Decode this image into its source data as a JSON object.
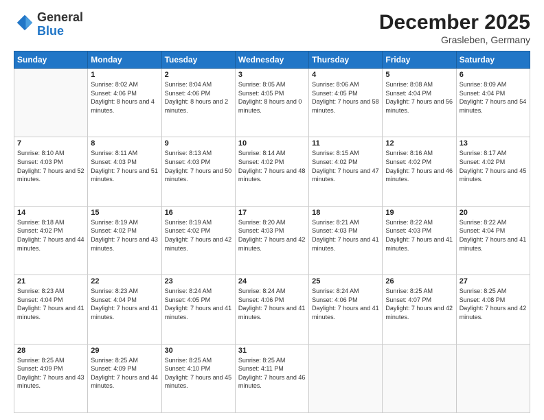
{
  "header": {
    "logo_general": "General",
    "logo_blue": "Blue",
    "month_title": "December 2025",
    "location": "Grasleben, Germany"
  },
  "weekdays": [
    "Sunday",
    "Monday",
    "Tuesday",
    "Wednesday",
    "Thursday",
    "Friday",
    "Saturday"
  ],
  "weeks": [
    [
      {
        "day": "",
        "sunrise": "",
        "sunset": "",
        "daylight": ""
      },
      {
        "day": "1",
        "sunrise": "Sunrise: 8:02 AM",
        "sunset": "Sunset: 4:06 PM",
        "daylight": "Daylight: 8 hours and 4 minutes."
      },
      {
        "day": "2",
        "sunrise": "Sunrise: 8:04 AM",
        "sunset": "Sunset: 4:06 PM",
        "daylight": "Daylight: 8 hours and 2 minutes."
      },
      {
        "day": "3",
        "sunrise": "Sunrise: 8:05 AM",
        "sunset": "Sunset: 4:05 PM",
        "daylight": "Daylight: 8 hours and 0 minutes."
      },
      {
        "day": "4",
        "sunrise": "Sunrise: 8:06 AM",
        "sunset": "Sunset: 4:05 PM",
        "daylight": "Daylight: 7 hours and 58 minutes."
      },
      {
        "day": "5",
        "sunrise": "Sunrise: 8:08 AM",
        "sunset": "Sunset: 4:04 PM",
        "daylight": "Daylight: 7 hours and 56 minutes."
      },
      {
        "day": "6",
        "sunrise": "Sunrise: 8:09 AM",
        "sunset": "Sunset: 4:04 PM",
        "daylight": "Daylight: 7 hours and 54 minutes."
      }
    ],
    [
      {
        "day": "7",
        "sunrise": "Sunrise: 8:10 AM",
        "sunset": "Sunset: 4:03 PM",
        "daylight": "Daylight: 7 hours and 52 minutes."
      },
      {
        "day": "8",
        "sunrise": "Sunrise: 8:11 AM",
        "sunset": "Sunset: 4:03 PM",
        "daylight": "Daylight: 7 hours and 51 minutes."
      },
      {
        "day": "9",
        "sunrise": "Sunrise: 8:13 AM",
        "sunset": "Sunset: 4:03 PM",
        "daylight": "Daylight: 7 hours and 50 minutes."
      },
      {
        "day": "10",
        "sunrise": "Sunrise: 8:14 AM",
        "sunset": "Sunset: 4:02 PM",
        "daylight": "Daylight: 7 hours and 48 minutes."
      },
      {
        "day": "11",
        "sunrise": "Sunrise: 8:15 AM",
        "sunset": "Sunset: 4:02 PM",
        "daylight": "Daylight: 7 hours and 47 minutes."
      },
      {
        "day": "12",
        "sunrise": "Sunrise: 8:16 AM",
        "sunset": "Sunset: 4:02 PM",
        "daylight": "Daylight: 7 hours and 46 minutes."
      },
      {
        "day": "13",
        "sunrise": "Sunrise: 8:17 AM",
        "sunset": "Sunset: 4:02 PM",
        "daylight": "Daylight: 7 hours and 45 minutes."
      }
    ],
    [
      {
        "day": "14",
        "sunrise": "Sunrise: 8:18 AM",
        "sunset": "Sunset: 4:02 PM",
        "daylight": "Daylight: 7 hours and 44 minutes."
      },
      {
        "day": "15",
        "sunrise": "Sunrise: 8:19 AM",
        "sunset": "Sunset: 4:02 PM",
        "daylight": "Daylight: 7 hours and 43 minutes."
      },
      {
        "day": "16",
        "sunrise": "Sunrise: 8:19 AM",
        "sunset": "Sunset: 4:02 PM",
        "daylight": "Daylight: 7 hours and 42 minutes."
      },
      {
        "day": "17",
        "sunrise": "Sunrise: 8:20 AM",
        "sunset": "Sunset: 4:03 PM",
        "daylight": "Daylight: 7 hours and 42 minutes."
      },
      {
        "day": "18",
        "sunrise": "Sunrise: 8:21 AM",
        "sunset": "Sunset: 4:03 PM",
        "daylight": "Daylight: 7 hours and 41 minutes."
      },
      {
        "day": "19",
        "sunrise": "Sunrise: 8:22 AM",
        "sunset": "Sunset: 4:03 PM",
        "daylight": "Daylight: 7 hours and 41 minutes."
      },
      {
        "day": "20",
        "sunrise": "Sunrise: 8:22 AM",
        "sunset": "Sunset: 4:04 PM",
        "daylight": "Daylight: 7 hours and 41 minutes."
      }
    ],
    [
      {
        "day": "21",
        "sunrise": "Sunrise: 8:23 AM",
        "sunset": "Sunset: 4:04 PM",
        "daylight": "Daylight: 7 hours and 41 minutes."
      },
      {
        "day": "22",
        "sunrise": "Sunrise: 8:23 AM",
        "sunset": "Sunset: 4:04 PM",
        "daylight": "Daylight: 7 hours and 41 minutes."
      },
      {
        "day": "23",
        "sunrise": "Sunrise: 8:24 AM",
        "sunset": "Sunset: 4:05 PM",
        "daylight": "Daylight: 7 hours and 41 minutes."
      },
      {
        "day": "24",
        "sunrise": "Sunrise: 8:24 AM",
        "sunset": "Sunset: 4:06 PM",
        "daylight": "Daylight: 7 hours and 41 minutes."
      },
      {
        "day": "25",
        "sunrise": "Sunrise: 8:24 AM",
        "sunset": "Sunset: 4:06 PM",
        "daylight": "Daylight: 7 hours and 41 minutes."
      },
      {
        "day": "26",
        "sunrise": "Sunrise: 8:25 AM",
        "sunset": "Sunset: 4:07 PM",
        "daylight": "Daylight: 7 hours and 42 minutes."
      },
      {
        "day": "27",
        "sunrise": "Sunrise: 8:25 AM",
        "sunset": "Sunset: 4:08 PM",
        "daylight": "Daylight: 7 hours and 42 minutes."
      }
    ],
    [
      {
        "day": "28",
        "sunrise": "Sunrise: 8:25 AM",
        "sunset": "Sunset: 4:09 PM",
        "daylight": "Daylight: 7 hours and 43 minutes."
      },
      {
        "day": "29",
        "sunrise": "Sunrise: 8:25 AM",
        "sunset": "Sunset: 4:09 PM",
        "daylight": "Daylight: 7 hours and 44 minutes."
      },
      {
        "day": "30",
        "sunrise": "Sunrise: 8:25 AM",
        "sunset": "Sunset: 4:10 PM",
        "daylight": "Daylight: 7 hours and 45 minutes."
      },
      {
        "day": "31",
        "sunrise": "Sunrise: 8:25 AM",
        "sunset": "Sunset: 4:11 PM",
        "daylight": "Daylight: 7 hours and 46 minutes."
      },
      {
        "day": "",
        "sunrise": "",
        "sunset": "",
        "daylight": ""
      },
      {
        "day": "",
        "sunrise": "",
        "sunset": "",
        "daylight": ""
      },
      {
        "day": "",
        "sunrise": "",
        "sunset": "",
        "daylight": ""
      }
    ]
  ]
}
